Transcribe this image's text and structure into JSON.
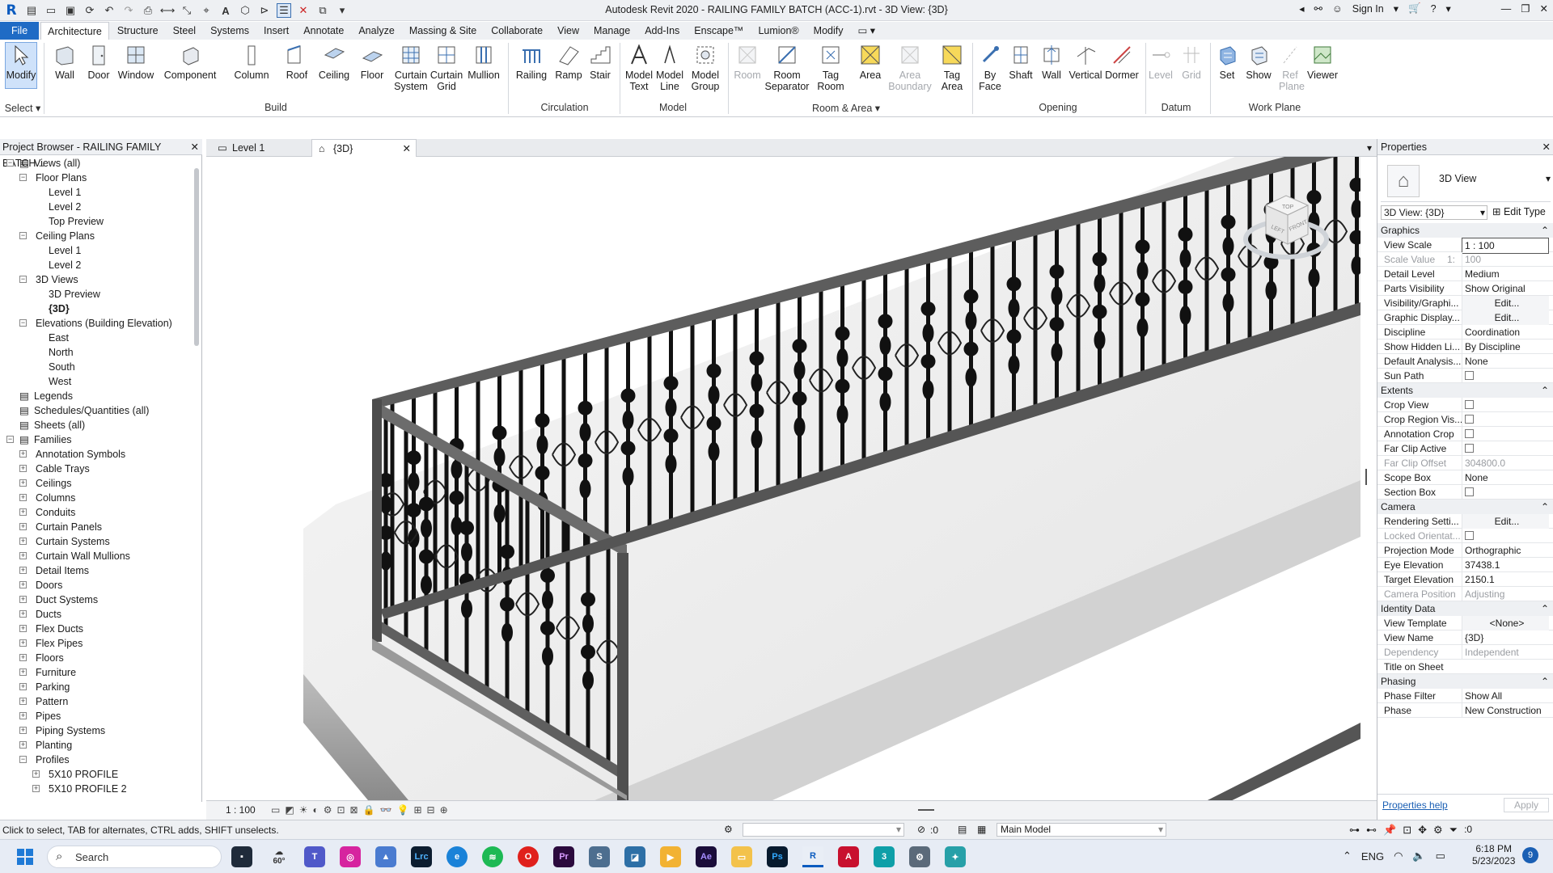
{
  "titlebar": {
    "app_title": "Autodesk Revit 2020 - RAILING FAMILY BATCH (ACC-1).rvt - 3D View: {3D}",
    "sign_in": "Sign In"
  },
  "ribbon_tabs": [
    "File",
    "Architecture",
    "Structure",
    "Steel",
    "Systems",
    "Insert",
    "Annotate",
    "Analyze",
    "Massing & Site",
    "Collaborate",
    "View",
    "Manage",
    "Add-Ins",
    "Enscape™",
    "Lumion®",
    "Modify"
  ],
  "ribbon": {
    "select": {
      "modify": "Modify",
      "panel": "Select ▾"
    },
    "build": {
      "wall": "Wall",
      "door": "Door",
      "window": "Window",
      "component": "Component",
      "column": "Column",
      "roof": "Roof",
      "ceiling": "Ceiling",
      "floor": "Floor",
      "curtain_system": "Curtain System",
      "curtain_grid": "Curtain Grid",
      "mullion": "Mullion",
      "panel": "Build"
    },
    "circulation": {
      "railing": "Railing",
      "ramp": "Ramp",
      "stair": "Stair",
      "panel": "Circulation"
    },
    "model": {
      "model_text": "Model Text",
      "model_line": "Model Line",
      "model_group": "Model Group",
      "panel": "Model"
    },
    "room_area": {
      "room": "Room",
      "room_separator": "Room Separator",
      "tag_room": "Tag Room",
      "area": "Area",
      "area_boundary": "Area Boundary",
      "tag_area": "Tag Area",
      "panel": "Room & Area ▾"
    },
    "opening": {
      "by_face": "By Face",
      "shaft": "Shaft",
      "wall": "Wall",
      "vertical": "Vertical",
      "dormer": "Dormer",
      "panel": "Opening"
    },
    "datum": {
      "level": "Level",
      "grid": "Grid",
      "panel": "Datum"
    },
    "work_plane": {
      "set": "Set",
      "show": "Show",
      "ref_plane": "Ref Plane",
      "viewer": "Viewer",
      "panel": "Work Plane"
    }
  },
  "project_browser": {
    "title": "Project Browser - RAILING FAMILY BATCH...",
    "tree": [
      {
        "label": "Views (all)",
        "depth": 0,
        "toggle": "−"
      },
      {
        "label": "Floor Plans",
        "depth": 1,
        "toggle": "−"
      },
      {
        "label": "Level 1",
        "depth": 2
      },
      {
        "label": "Level 2",
        "depth": 2
      },
      {
        "label": "Top Preview",
        "depth": 2
      },
      {
        "label": "Ceiling Plans",
        "depth": 1,
        "toggle": "−"
      },
      {
        "label": "Level 1",
        "depth": 2
      },
      {
        "label": "Level 2",
        "depth": 2
      },
      {
        "label": "3D Views",
        "depth": 1,
        "toggle": "−"
      },
      {
        "label": "3D Preview",
        "depth": 2
      },
      {
        "label": "{3D}",
        "depth": 2,
        "bold": true
      },
      {
        "label": "Elevations (Building Elevation)",
        "depth": 1,
        "toggle": "−"
      },
      {
        "label": "East",
        "depth": 2
      },
      {
        "label": "North",
        "depth": 2
      },
      {
        "label": "South",
        "depth": 2
      },
      {
        "label": "West",
        "depth": 2
      },
      {
        "label": "Legends",
        "depth": 0
      },
      {
        "label": "Schedules/Quantities (all)",
        "depth": 0
      },
      {
        "label": "Sheets (all)",
        "depth": 0
      },
      {
        "label": "Families",
        "depth": 0,
        "toggle": "−"
      },
      {
        "label": "Annotation Symbols",
        "depth": 1,
        "toggle": "+"
      },
      {
        "label": "Cable Trays",
        "depth": 1,
        "toggle": "+"
      },
      {
        "label": "Ceilings",
        "depth": 1,
        "toggle": "+"
      },
      {
        "label": "Columns",
        "depth": 1,
        "toggle": "+"
      },
      {
        "label": "Conduits",
        "depth": 1,
        "toggle": "+"
      },
      {
        "label": "Curtain Panels",
        "depth": 1,
        "toggle": "+"
      },
      {
        "label": "Curtain Systems",
        "depth": 1,
        "toggle": "+"
      },
      {
        "label": "Curtain Wall Mullions",
        "depth": 1,
        "toggle": "+"
      },
      {
        "label": "Detail Items",
        "depth": 1,
        "toggle": "+"
      },
      {
        "label": "Doors",
        "depth": 1,
        "toggle": "+"
      },
      {
        "label": "Duct Systems",
        "depth": 1,
        "toggle": "+"
      },
      {
        "label": "Ducts",
        "depth": 1,
        "toggle": "+"
      },
      {
        "label": "Flex Ducts",
        "depth": 1,
        "toggle": "+"
      },
      {
        "label": "Flex Pipes",
        "depth": 1,
        "toggle": "+"
      },
      {
        "label": "Floors",
        "depth": 1,
        "toggle": "+"
      },
      {
        "label": "Furniture",
        "depth": 1,
        "toggle": "+"
      },
      {
        "label": "Parking",
        "depth": 1,
        "toggle": "+"
      },
      {
        "label": "Pattern",
        "depth": 1,
        "toggle": "+"
      },
      {
        "label": "Pipes",
        "depth": 1,
        "toggle": "+"
      },
      {
        "label": "Piping Systems",
        "depth": 1,
        "toggle": "+"
      },
      {
        "label": "Planting",
        "depth": 1,
        "toggle": "+"
      },
      {
        "label": "Profiles",
        "depth": 1,
        "toggle": "−"
      },
      {
        "label": "5X10 PROFILE",
        "depth": 2,
        "toggle": "+"
      },
      {
        "label": "5X10 PROFILE 2",
        "depth": 2,
        "toggle": "+"
      }
    ]
  },
  "view_tabs": [
    {
      "label": "Level 1"
    },
    {
      "label": "{3D}",
      "active": true
    }
  ],
  "viewcube": {
    "top": "TOP",
    "left": "LEFT",
    "front": "FRONT"
  },
  "view_controls": {
    "scale": "1 : 100"
  },
  "properties": {
    "title": "Properties",
    "type_name": "3D View",
    "selector": "3D View: {3D}",
    "edit_type": "Edit Type",
    "groups": [
      {
        "name": "Graphics",
        "rows": [
          {
            "k": "View Scale",
            "v": "1 : 100",
            "box": true
          },
          {
            "k": "Scale Value",
            "v": "100",
            "k2": "1:",
            "dim": true
          },
          {
            "k": "Detail Level",
            "v": "Medium"
          },
          {
            "k": "Parts Visibility",
            "v": "Show Original"
          },
          {
            "k": "Visibility/Graphi...",
            "v": "Edit...",
            "btn": true
          },
          {
            "k": "Graphic Display...",
            "v": "Edit...",
            "btn": true
          },
          {
            "k": "Discipline",
            "v": "Coordination"
          },
          {
            "k": "Show Hidden Li...",
            "v": "By Discipline"
          },
          {
            "k": "Default Analysis...",
            "v": "None"
          },
          {
            "k": "Sun Path",
            "cb": true
          }
        ]
      },
      {
        "name": "Extents",
        "rows": [
          {
            "k": "Crop View",
            "cb": true
          },
          {
            "k": "Crop Region Vis...",
            "cb": true
          },
          {
            "k": "Annotation Crop",
            "cb": true
          },
          {
            "k": "Far Clip Active",
            "cb": true
          },
          {
            "k": "Far Clip Offset",
            "v": "304800.0",
            "dim": true
          },
          {
            "k": "Scope Box",
            "v": "None"
          },
          {
            "k": "Section Box",
            "cb": true
          }
        ]
      },
      {
        "name": "Camera",
        "rows": [
          {
            "k": "Rendering Setti...",
            "v": "Edit...",
            "btn": true
          },
          {
            "k": "Locked Orientat...",
            "cb": true,
            "dim": true
          },
          {
            "k": "Projection Mode",
            "v": "Orthographic"
          },
          {
            "k": "Eye Elevation",
            "v": "37438.1"
          },
          {
            "k": "Target Elevation",
            "v": "2150.1"
          },
          {
            "k": "Camera Position",
            "v": "Adjusting",
            "dim": true
          }
        ]
      },
      {
        "name": "Identity Data",
        "rows": [
          {
            "k": "View Template",
            "v": "<None>",
            "btn": true
          },
          {
            "k": "View Name",
            "v": "{3D}"
          },
          {
            "k": "Dependency",
            "v": "Independent",
            "dim": true
          },
          {
            "k": "Title on Sheet",
            "v": ""
          }
        ]
      },
      {
        "name": "Phasing",
        "rows": [
          {
            "k": "Phase Filter",
            "v": "Show All"
          },
          {
            "k": "Phase",
            "v": "New Construction"
          }
        ]
      }
    ],
    "help_link": "Properties help",
    "apply": "Apply"
  },
  "statusbar": {
    "hint": "Click to select, TAB for alternates, CTRL adds, SHIFT unselects.",
    "zero": ":0",
    "model": "Main Model",
    "filter_count": ":0"
  },
  "taskbar": {
    "search": "Search",
    "weather": "60°",
    "lang": "ENG",
    "time": "6:18 PM",
    "date": "5/23/2023",
    "badge": "9"
  },
  "colors": {
    "file_tab": "#1f6bc5",
    "accent": "#0b5bbf"
  }
}
